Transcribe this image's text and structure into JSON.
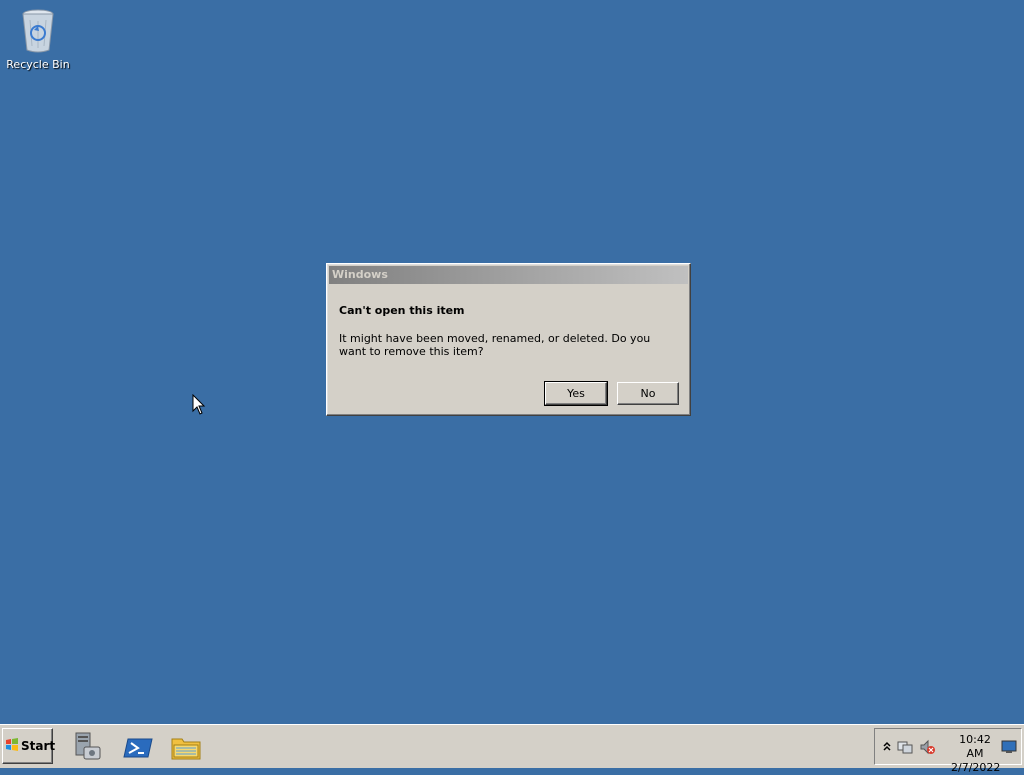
{
  "desktop": {
    "icons": [
      {
        "label": "Recycle Bin",
        "icon": "recycle-bin-icon"
      }
    ]
  },
  "dialog": {
    "title": "Windows",
    "heading": "Can't open this item",
    "body": "It might have been moved, renamed, or deleted. Do you want to remove this item?",
    "buttons": {
      "yes": "Yes",
      "no": "No"
    }
  },
  "taskbar": {
    "start_label": "Start",
    "pinned": [
      {
        "icon": "server-manager-icon"
      },
      {
        "icon": "powershell-icon"
      },
      {
        "icon": "file-explorer-icon"
      }
    ],
    "tray": {
      "icons": [
        "show-hidden-icons-icon",
        "network-icon",
        "volume-muted-icon"
      ],
      "time": "10:42 AM",
      "date": "2/7/2022"
    }
  },
  "colors": {
    "desktop_bg": "#3a6ea5",
    "chrome": "#d4d0c8",
    "title_gradient_start": "#808080",
    "title_gradient_end": "#c0c0c0"
  }
}
